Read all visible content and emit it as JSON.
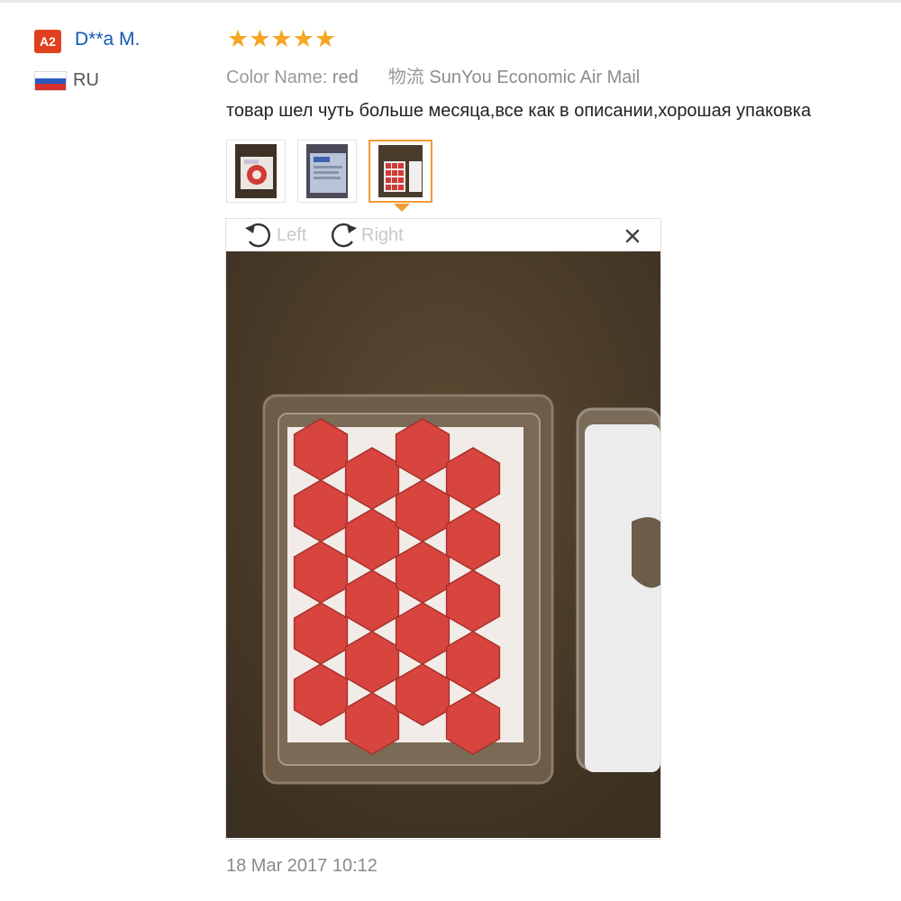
{
  "reviewer": {
    "level_badge": "A2",
    "name": "D**a M.",
    "country": "RU",
    "flag_colors": [
      "#ffffff",
      "#2c5bbf",
      "#d8302c"
    ]
  },
  "review": {
    "rating_stars": "★★★★★",
    "rating": 5,
    "color_label": "Color Name:",
    "color_value": "red",
    "shipping_label": "物流",
    "shipping_value": "SunYou Economic Air Mail",
    "text": "товар шел чуть больше месяца,все как в описании,хорошая упаковка",
    "date": "18 Mar 2017 10:12"
  },
  "thumbnails": [
    {
      "name": "photo-1",
      "active": false
    },
    {
      "name": "photo-2",
      "active": false
    },
    {
      "name": "photo-3",
      "active": true
    }
  ],
  "viewer": {
    "rotate_left_label": "Left",
    "rotate_right_label": "Right",
    "close_symbol": "×"
  },
  "colors": {
    "accent_orange": "#f39a35",
    "star": "#f6a623",
    "badge": "#e1401e",
    "link_blue": "#1058b5",
    "cap_red": "#d8453f"
  }
}
